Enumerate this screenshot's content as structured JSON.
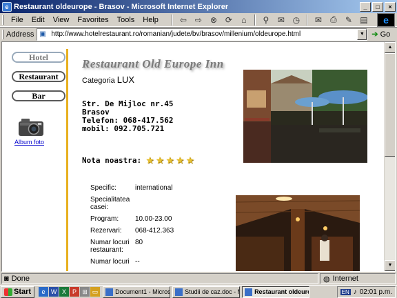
{
  "window": {
    "title": "Restaurant oldeurope - Brasov - Microsoft Internet Explorer",
    "minimize": "_",
    "maximize": "□",
    "close": "×"
  },
  "menu": [
    "File",
    "Edit",
    "View",
    "Favorites",
    "Tools",
    "Help"
  ],
  "address": {
    "label": "Address",
    "url": "http://www.hotelrestaurant.ro/romanian/judete/bv/brasov/millenium/oldeurope.html",
    "go_label": "Go"
  },
  "nav": {
    "hotel": "Hotel",
    "restaurant": "Restaurant",
    "bar": "Bar",
    "album": "Album foto"
  },
  "restaurant": {
    "title": "Restaurant Old Europe Inn",
    "category_label": "Categoria",
    "category_value": "LUX",
    "street": "Str. De Mijloc nr.45",
    "city": "Brasov",
    "phone": "Telefon: 068-417.562",
    "mobile": "mobil: 092.705.721",
    "rating_label": "Nota noastra:",
    "stars": 5
  },
  "details": [
    {
      "k": "Specific:",
      "v": "international"
    },
    {
      "k": "Specialitatea casei:",
      "v": ""
    },
    {
      "k": "Program:",
      "v": "10.00-23.00"
    },
    {
      "k": "Rezervari:",
      "v": "068-412.363"
    },
    {
      "k": "Numar locuri restaurant:",
      "v": "80"
    },
    {
      "k": "Numar locuri",
      "v": "--"
    }
  ],
  "status": {
    "text": "Done",
    "zone": "Internet"
  },
  "taskbar": {
    "start": "Start",
    "tasks": [
      "Document1 - Microsoft ...",
      "Studii de caz.doc - Micr...",
      "Restaurant oldeuro..."
    ],
    "lang": "EN",
    "time": "02:01 p.m."
  }
}
